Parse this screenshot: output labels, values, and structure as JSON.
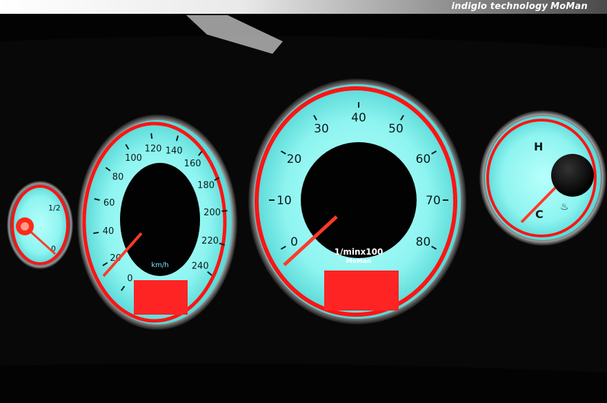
{
  "header": {
    "text": "indiglo technology",
    "brand": "MoMan"
  },
  "colors": {
    "dial": "#86f2ef",
    "ring": "#ff1414",
    "needle": "#ff3a2a",
    "background": "#030303"
  },
  "speedometer": {
    "ticks": [
      "0",
      "20",
      "40",
      "60",
      "80",
      "100",
      "120",
      "140",
      "160",
      "180",
      "200",
      "220",
      "240"
    ],
    "unit": "km/h"
  },
  "tachometer": {
    "ticks": [
      "0",
      "10",
      "20",
      "30",
      "40",
      "50",
      "60",
      "70",
      "80"
    ],
    "unit": "1/minx100",
    "brand": "MoMan"
  },
  "fuel_gauge": {
    "ticks": [
      "1/2",
      "0"
    ]
  },
  "temp_gauge": {
    "high": "H",
    "low": "C"
  }
}
